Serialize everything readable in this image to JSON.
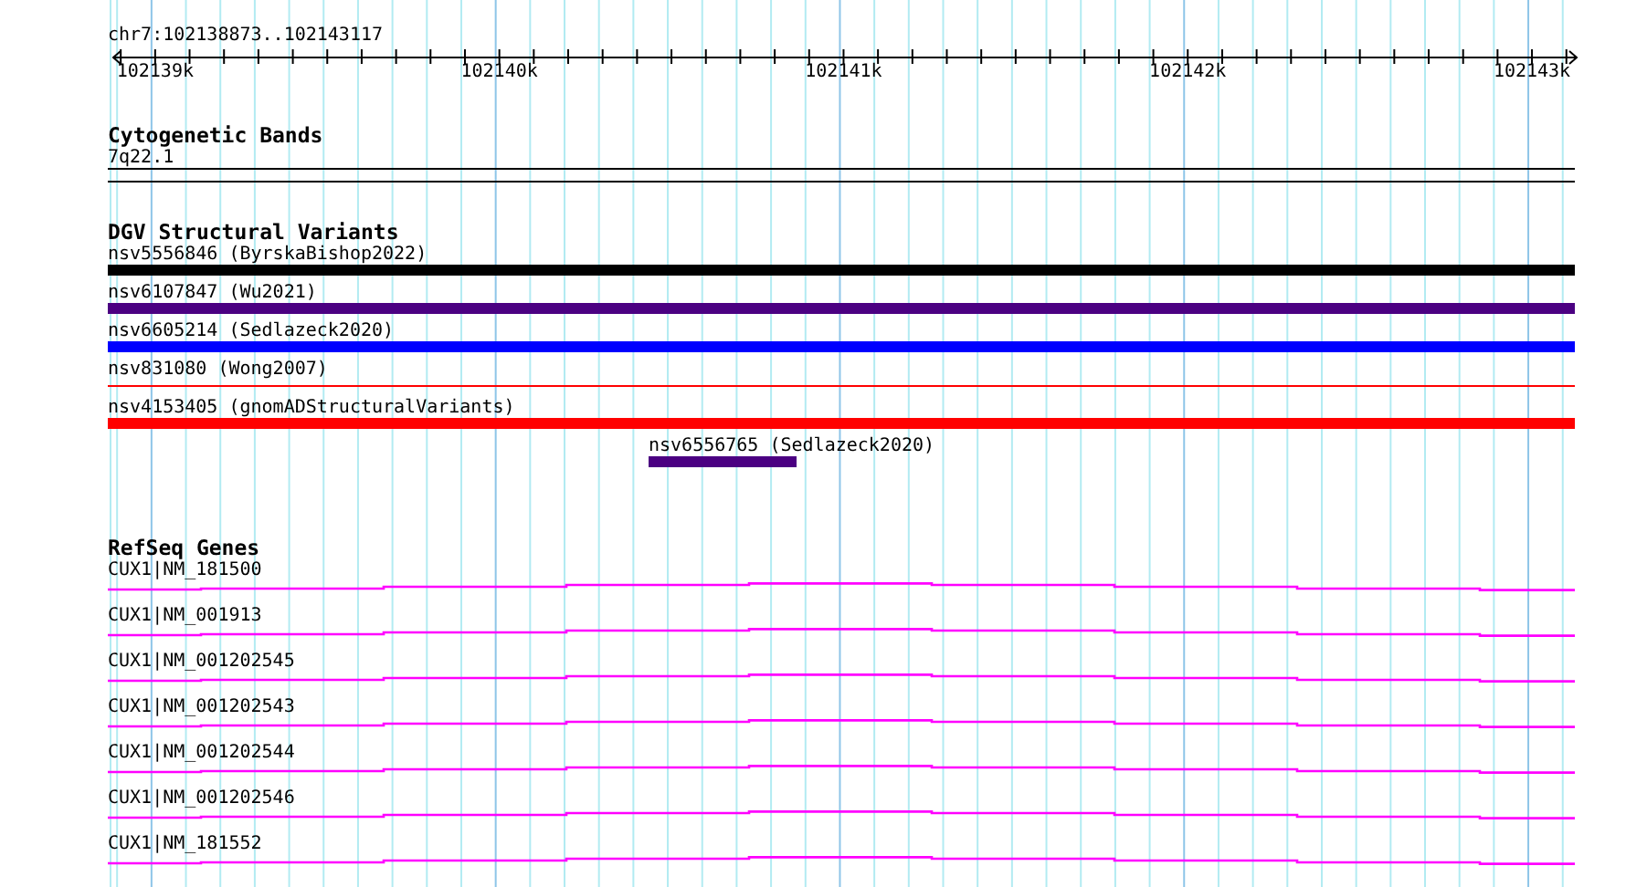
{
  "locus": "chr7:102138873..102143117",
  "ruler": {
    "ticks": [
      "102139k",
      "102140k",
      "102141k",
      "102142k",
      "102143k"
    ]
  },
  "tracks": [
    {
      "kind": "cytobands",
      "title": "Cytogenetic Bands",
      "features": [
        {
          "label": "7q22.1"
        }
      ]
    },
    {
      "kind": "variants",
      "title": "DGV Structural Variants",
      "features": [
        {
          "label": "nsv5556846 (ByrskaBishop2022)",
          "kind": "full",
          "color": "#000000"
        },
        {
          "label": "nsv6107847 (Wu2021)",
          "kind": "full",
          "color": "#4b0082"
        },
        {
          "label": "nsv6605214 (Sedlazeck2020)",
          "kind": "full",
          "color": "#0000ff"
        },
        {
          "label": "nsv831080 (Wong2007)",
          "kind": "thin",
          "color": "#ff0000"
        },
        {
          "label": "nsv4153405 (gnomADStructuralVariants)",
          "kind": "full",
          "color": "#ff0000"
        },
        {
          "label": "nsv6556765 (Sedlazeck2020)",
          "kind": "short",
          "color": "#4b0082"
        }
      ]
    },
    {
      "kind": "genes",
      "title": "RefSeq Genes",
      "features": [
        {
          "label": "CUX1|NM_181500"
        },
        {
          "label": "CUX1|NM_001913"
        },
        {
          "label": "CUX1|NM_001202545"
        },
        {
          "label": "CUX1|NM_001202543"
        },
        {
          "label": "CUX1|NM_001202544"
        },
        {
          "label": "CUX1|NM_001202546"
        },
        {
          "label": "CUX1|NM_181552"
        }
      ]
    }
  ]
}
